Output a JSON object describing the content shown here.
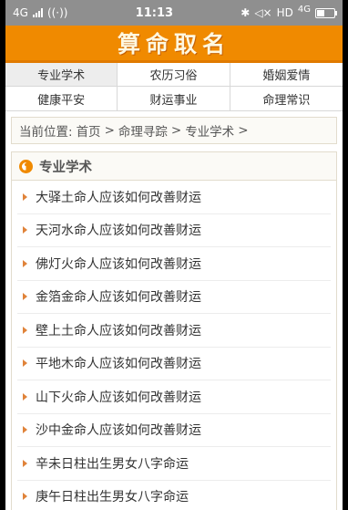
{
  "status_bar": {
    "network": "4G",
    "time": "11:13",
    "hd_label": "HD",
    "network_right": "4G"
  },
  "header": {
    "title": "算命取名"
  },
  "nav": [
    {
      "label": "专业学术"
    },
    {
      "label": "农历习俗"
    },
    {
      "label": "婚姻爱情"
    },
    {
      "label": "健康平安"
    },
    {
      "label": "财运事业"
    },
    {
      "label": "命理常识"
    }
  ],
  "breadcrumb": {
    "prefix": "当前位置:",
    "items": [
      "首页",
      "命理寻踪",
      "专业学术"
    ],
    "separator": ">"
  },
  "section": {
    "title": "专业学术",
    "items": [
      "大驿土命人应该如何改善财运",
      "天河水命人应该如何改善财运",
      "佛灯火命人应该如何改善财运",
      "金箔金命人应该如何改善财运",
      "壁上土命人应该如何改善财运",
      "平地木命人应该如何改善财运",
      "山下火命人应该如何改善财运",
      "沙中金命人应该如何改善财运",
      "辛未日柱出生男女八字命运",
      "庚午日柱出生男女八字命运"
    ]
  }
}
